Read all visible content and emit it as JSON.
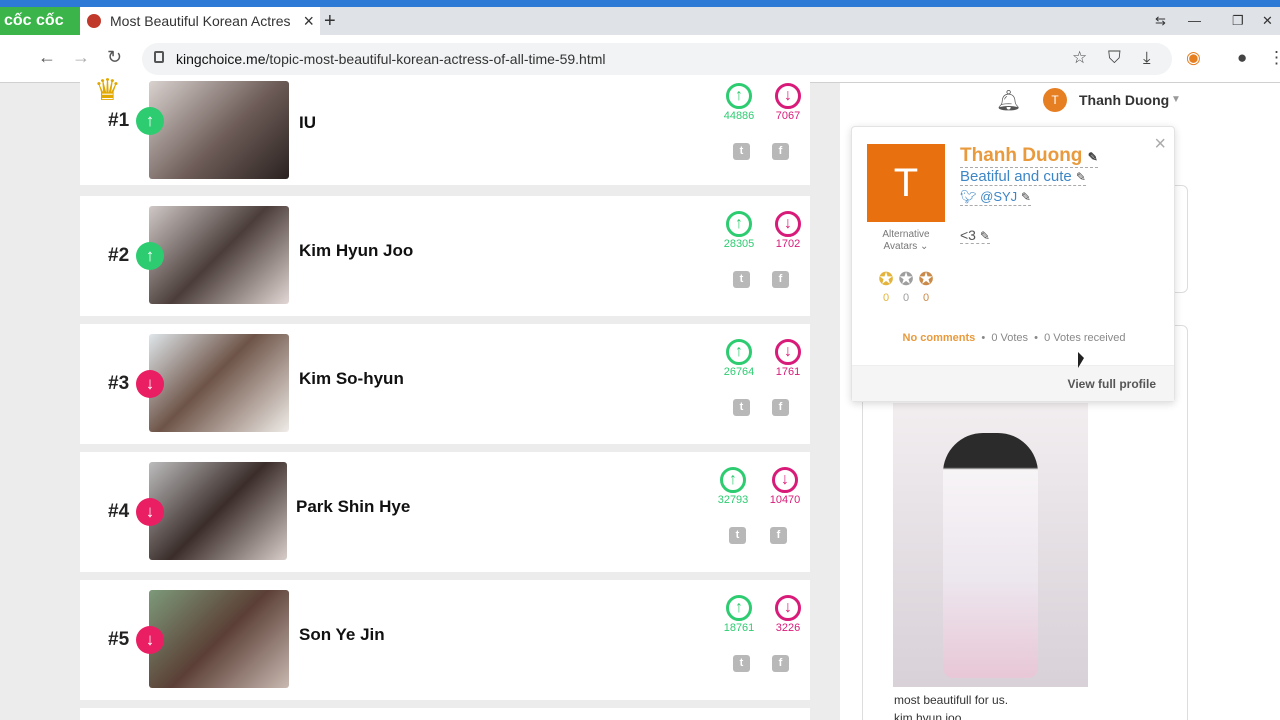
{
  "browser": {
    "brand": "cốc cốc",
    "tab_title": "Most Beautiful Korean Actress",
    "url_domain": "kingchoice.me",
    "url_path": "/topic-most-beautiful-korean-actress-of-all-time-59.html"
  },
  "header": {
    "user_initial": "T",
    "user_name": "Thanh Duong"
  },
  "entries": [
    {
      "rank": "#1",
      "name": "IU",
      "trend": "up",
      "up_votes": "44886",
      "down_votes": "7067"
    },
    {
      "rank": "#2",
      "name": "Kim Hyun Joo",
      "trend": "up",
      "up_votes": "28305",
      "down_votes": "1702"
    },
    {
      "rank": "#3",
      "name": "Kim So-hyun",
      "trend": "down",
      "up_votes": "26764",
      "down_votes": "1761"
    },
    {
      "rank": "#4",
      "name": "Park Shin Hye",
      "trend": "down",
      "up_votes": "32793",
      "down_votes": "10470"
    },
    {
      "rank": "#5",
      "name": "Son Ye Jin",
      "trend": "down",
      "up_votes": "18761",
      "down_votes": "3226"
    }
  ],
  "profile_popup": {
    "initial": "T",
    "name": "Thanh Duong",
    "bio": "Beatiful and cute",
    "twitter": "@SYJ",
    "heart": "<3",
    "alt_avatars": "Alternative Avatars",
    "medals": [
      {
        "color": "#e3b33c",
        "count": "0"
      },
      {
        "color": "#9e9e9e",
        "count": "0"
      },
      {
        "color": "#c98a4a",
        "count": "0"
      }
    ],
    "comments": "No comments",
    "votes": "0 Votes",
    "votes_received": "0 Votes received",
    "view_full": "View full profile"
  },
  "post": {
    "caption_line1": "most beautifull for us.",
    "caption_line2": "kim hyun joo"
  }
}
